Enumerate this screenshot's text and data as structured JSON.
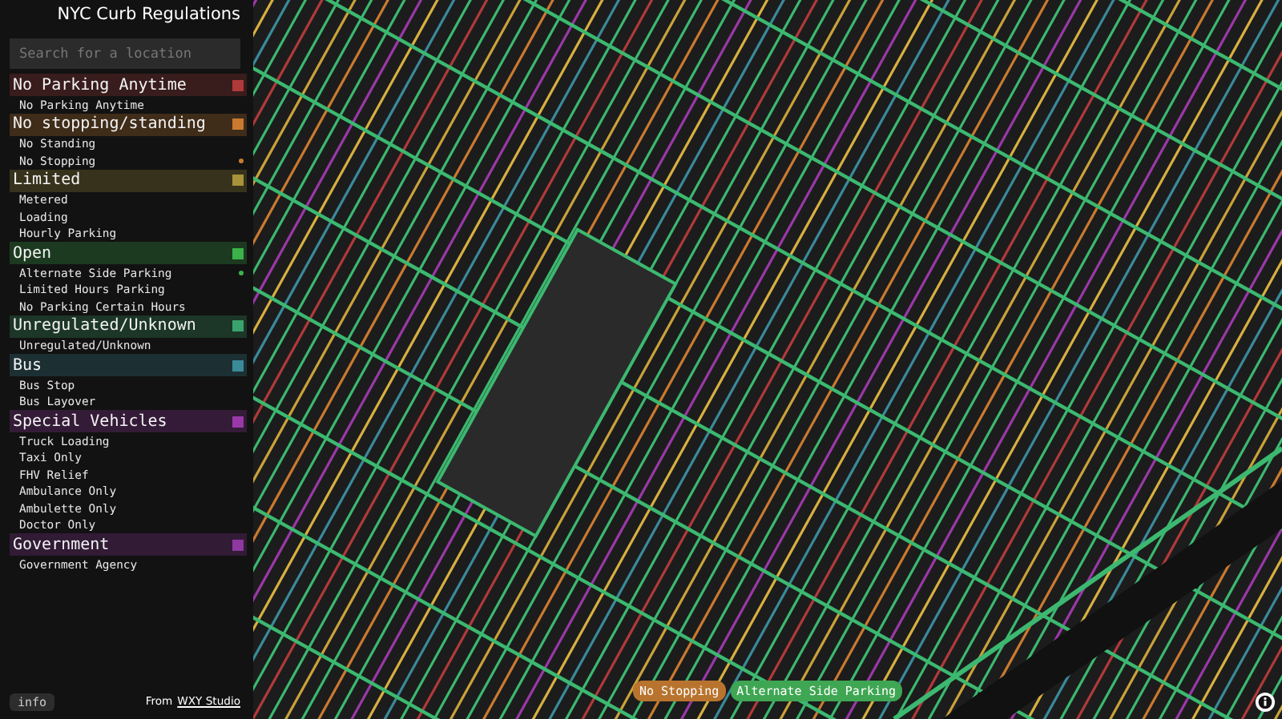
{
  "title": "NYC Curb Regulations",
  "search": {
    "placeholder": "Search for a location"
  },
  "categories": [
    {
      "name": "No Parking Anytime",
      "color": "#b03a3a",
      "items": [
        {
          "label": "No Parking Anytime",
          "selected": false
        }
      ]
    },
    {
      "name": "No stopping/standing",
      "color": "#c97a30",
      "items": [
        {
          "label": "No Standing",
          "selected": false
        },
        {
          "label": "No Stopping",
          "selected": true
        }
      ]
    },
    {
      "name": "Limited",
      "color": "#a8923a",
      "items": [
        {
          "label": "Metered",
          "selected": false
        },
        {
          "label": "Loading",
          "selected": false
        },
        {
          "label": "Hourly Parking",
          "selected": false
        }
      ]
    },
    {
      "name": "Open",
      "color": "#3cb34a",
      "items": [
        {
          "label": "Alternate Side Parking",
          "selected": true
        },
        {
          "label": "Limited Hours Parking",
          "selected": false
        },
        {
          "label": "No Parking Certain Hours",
          "selected": false
        }
      ]
    },
    {
      "name": "Unregulated/Unknown",
      "color": "#3aa36c",
      "items": [
        {
          "label": "Unregulated/Unknown",
          "selected": false
        }
      ]
    },
    {
      "name": "Bus",
      "color": "#3a8a9a",
      "items": [
        {
          "label": "Bus Stop",
          "selected": false
        },
        {
          "label": "Bus Layover",
          "selected": false
        }
      ]
    },
    {
      "name": "Special Vehicles",
      "color": "#9a38a8",
      "items": [
        {
          "label": "Truck Loading",
          "selected": false
        },
        {
          "label": "Taxi Only",
          "selected": false
        },
        {
          "label": "FHV Relief",
          "selected": false
        },
        {
          "label": "Ambulance Only",
          "selected": false
        },
        {
          "label": "Ambulette Only",
          "selected": false
        },
        {
          "label": "Doctor Only",
          "selected": false
        }
      ]
    },
    {
      "name": "Government",
      "color": "#8e38a0",
      "items": [
        {
          "label": "Government Agency",
          "selected": false
        }
      ]
    }
  ],
  "info_button": "info",
  "credit": {
    "prefix": "From",
    "link": "WXY Studio"
  },
  "active_filters": [
    {
      "label": "No Stopping",
      "color": "#b8742e"
    },
    {
      "label": "Alternate Side Parking",
      "color": "#3fa653"
    }
  ]
}
